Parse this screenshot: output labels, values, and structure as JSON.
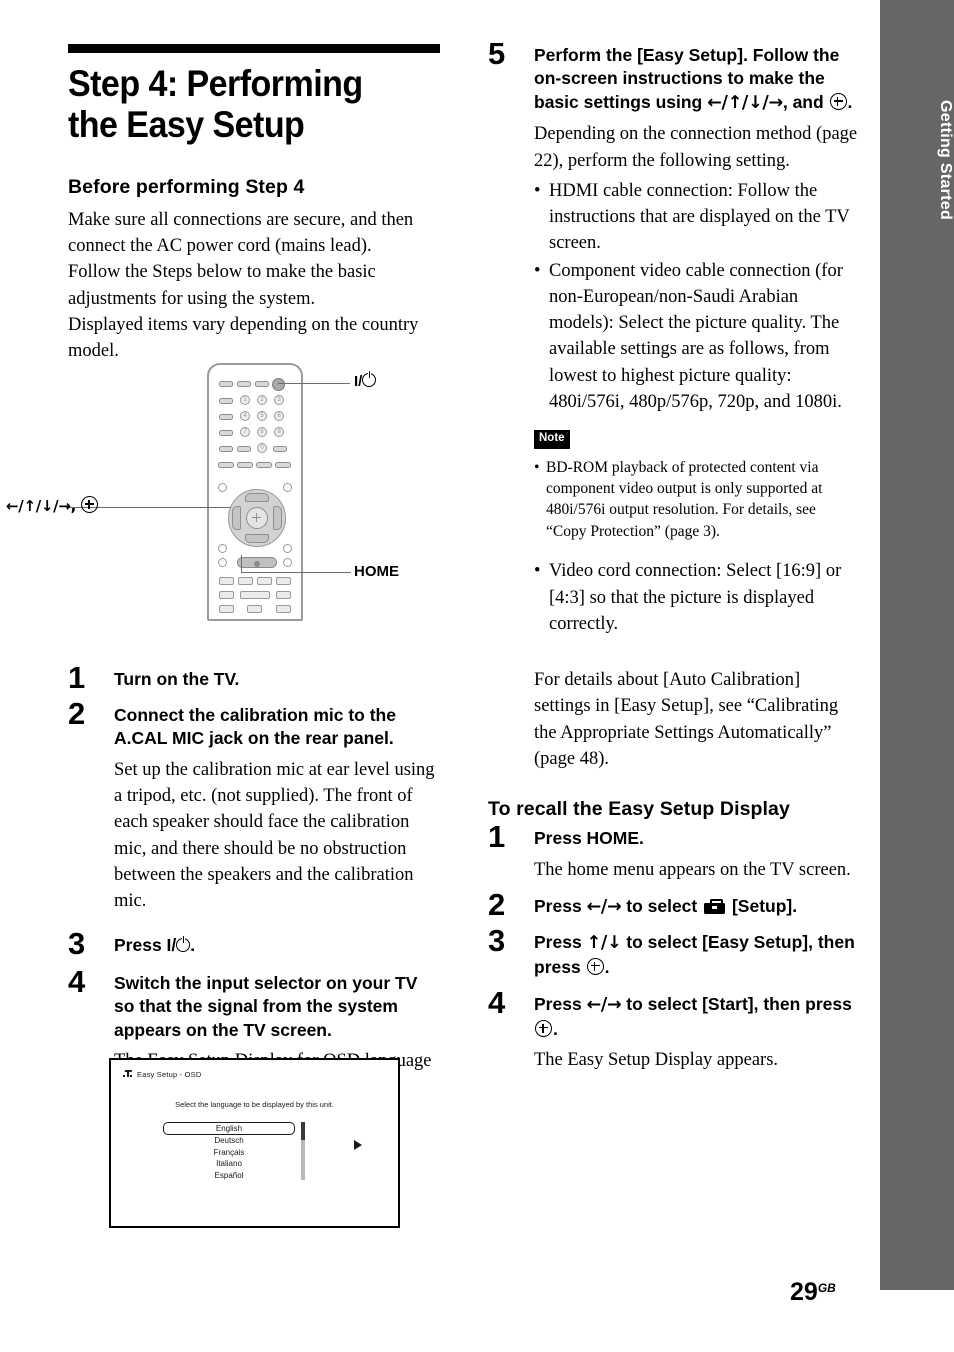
{
  "sidebar": {
    "label": "Getting Started"
  },
  "page": {
    "number": "29",
    "suffix": "GB"
  },
  "left_column": {
    "title": "Step 4: Performing the Easy Setup",
    "before_heading": "Before performing Step 4",
    "before_body": "Make sure all connections are secure, and then connect the AC power cord (mains lead). Follow the Steps below to make the basic adjustments for using the system. Displayed items vary depending on the country model.",
    "steps": [
      {
        "num": "1",
        "title": "Turn on the TV.",
        "body": ""
      },
      {
        "num": "2",
        "title": "Connect the calibration mic to the A.CAL MIC jack on the rear panel.",
        "body": "Set up the calibration mic at ear level using a tripod, etc. (not supplied). The front of each speaker should face the calibration mic, and there should be no obstruction between the speakers and the calibration mic."
      },
      {
        "num": "3",
        "title_prefix": "Press ",
        "title_suffix": ".",
        "title": "Press I/⏻.",
        "body": ""
      },
      {
        "num": "4",
        "title": "Switch the input selector on your TV so that the signal from the system appears on the TV screen.",
        "body": "The Easy Setup Display for OSD language selection appears."
      }
    ]
  },
  "remote_figure": {
    "label_power": "I/⏻",
    "label_dpad": "←/↑/↓/→,",
    "label_home": "HOME",
    "number_keys": [
      "1",
      "2",
      "3",
      "4",
      "5",
      "6",
      "7",
      "8",
      "9",
      "0"
    ]
  },
  "osd": {
    "title": "Easy Setup - OSD",
    "prompt": "Select the language to be displayed by this unit.",
    "languages": [
      "English",
      "Deutsch",
      "Français",
      "Italiano",
      "Español"
    ],
    "selected": "English"
  },
  "right_column": {
    "step5": {
      "num": "5",
      "title_a": "Perform the [Easy Setup]. Follow the on-screen instructions to make the basic settings using ",
      "title_arrows": "←/↑/↓/→",
      "title_b": ", and ",
      "title_c": ".",
      "body": "Depending on the connection method (page 22), perform the following setting.",
      "bullets": [
        "HDMI cable connection: Follow the instructions that are displayed on the TV screen.",
        "Component video cable connection (for non-European/non-Saudi Arabian models): Select the picture quality. The available settings are as follows, from lowest to highest picture quality: 480i/576i, 480p/576p, 720p, and 1080i."
      ]
    },
    "note": {
      "badge": "Note",
      "items": [
        "BD-ROM playback of protected content via component video output is only supported at 480i/576i output resolution. For details, see “Copy Protection” (page 3)."
      ]
    },
    "bullets_after_note": [
      "Video cord connection: Select [16:9] or [4:3] so that the picture is displayed correctly."
    ],
    "closing_paragraph": "For details about [Auto Calibration] settings in [Easy Setup], see “Calibrating the Appropriate Settings Automatically” (page 48).",
    "recall_heading": "To recall the Easy Setup Display",
    "recall_steps": [
      {
        "num": "1",
        "title": "Press HOME.",
        "body": "The home menu appears on the TV screen."
      },
      {
        "num": "2",
        "title_a": "Press ",
        "title_arrows": "←/→",
        "title_b": " to select ",
        "title_c": " [Setup].",
        "body": ""
      },
      {
        "num": "3",
        "title_a": "Press ",
        "title_arrows": "↑/↓",
        "title_b": " to select [Easy Setup], then press ",
        "title_c": ".",
        "body": ""
      },
      {
        "num": "4",
        "title_a": "Press ",
        "title_arrows": "←/→",
        "title_b": " to select [Start], then press ",
        "title_c": ".",
        "body": "The Easy Setup Display appears."
      }
    ]
  }
}
